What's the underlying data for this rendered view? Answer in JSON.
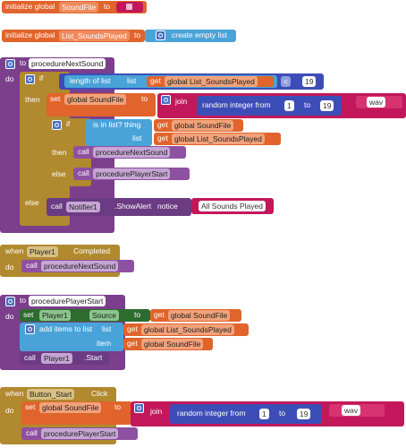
{
  "block1": {
    "label": "initialize global",
    "name": "SoundFile",
    "to": "to"
  },
  "block2": {
    "label": "initialize global",
    "name": "List_SoundsPlayed",
    "to": "to",
    "value": "create empty list"
  },
  "proc1": {
    "to": "to",
    "name": "procedureNextSound",
    "do": "do",
    "if": "if",
    "then": "then",
    "else": "else",
    "length_of_list": "length of list",
    "list": "list",
    "get": "get",
    "list_var": "global List_SoundsPlayed",
    "compare_op": "<",
    "compare_value": "19",
    "set": "set",
    "set_var": "global SoundFile",
    "set_to": "to",
    "join": "join",
    "random_integer_from": "random integer from",
    "rand_from": "1",
    "rand_to_label": "to",
    "rand_to": "19",
    "ext": "wav",
    "inner_if": "if",
    "is_in_list": "is in list? thing",
    "thing_get": "get",
    "thing_var": "global SoundFile",
    "list_label": "list",
    "list_get": "get",
    "list_get_var": "global List_SoundsPlayed",
    "inner_then": "then",
    "call": "call",
    "call_next": "procedureNextSound",
    "inner_else": "else",
    "call_player_start": "procedurePlayerStart",
    "notifier_component": "Notifier1",
    "notifier_method": ".ShowAlert",
    "notice": "notice",
    "notice_text": "All Sounds Played"
  },
  "event1": {
    "when": "when",
    "component": "Player1",
    "event": "Completed",
    "do": "do",
    "call": "call",
    "proc": "procedureNextSound"
  },
  "proc2": {
    "to": "to",
    "name": "procedurePlayerStart",
    "do": "do",
    "set": "set",
    "component": "Player1",
    "property": "Source",
    "set_to": "to",
    "get": "get",
    "get_var": "global SoundFile",
    "add_items": "add items to list",
    "list": "list",
    "list_get": "get",
    "list_var": "global List_SoundsPlayed",
    "item": "item",
    "item_get": "get",
    "item_var": "global SoundFile",
    "call": "call",
    "start_component": "Player1",
    "start_method": ".Start"
  },
  "event2": {
    "when": "when",
    "component": "Button_Start",
    "event": "Click",
    "do": "do",
    "set": "set",
    "set_var": "global SoundFile",
    "set_to": "to",
    "join": "join",
    "random_integer_from": "random integer from",
    "rand_from": "1",
    "rand_to_label": "to",
    "rand_to": "19",
    "ext": "wav",
    "call": "call",
    "proc": "procedurePlayerStart"
  }
}
